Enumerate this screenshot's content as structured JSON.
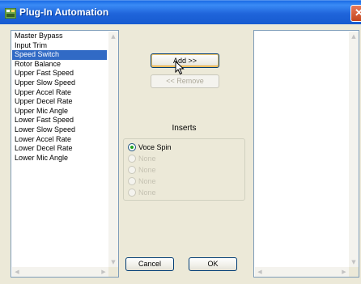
{
  "window": {
    "title": "Plug-In Automation",
    "close_glyph": "✕"
  },
  "available_list": {
    "items": [
      "Master Bypass",
      "Input Trim",
      "Speed Switch",
      "Rotor Balance",
      "Upper Fast Speed",
      "Upper Slow Speed",
      "Upper Accel Rate",
      "Upper Decel Rate",
      "Upper Mic Angle",
      "Lower Fast Speed",
      "Lower Slow Speed",
      "Lower Accel Rate",
      "Lower Decel Rate",
      "Lower Mic Angle"
    ],
    "selected": "Speed Switch"
  },
  "automated_list": {
    "items": []
  },
  "buttons": {
    "add_label": "Add >>",
    "remove_label": "<< Remove",
    "cancel_label": "Cancel",
    "ok_label": "OK"
  },
  "inserts": {
    "label": "Inserts",
    "options": [
      {
        "label": "Voce Spin",
        "selected": true,
        "enabled": true
      },
      {
        "label": "None",
        "selected": false,
        "enabled": false
      },
      {
        "label": "None",
        "selected": false,
        "enabled": false
      },
      {
        "label": "None",
        "selected": false,
        "enabled": false
      },
      {
        "label": "None",
        "selected": false,
        "enabled": false
      }
    ]
  },
  "icons": {
    "title_icon": "plugin-app-icon",
    "cursor": "mouse-pointer-icon"
  },
  "colors": {
    "titlebar": "#1f64da",
    "selection": "#316ac5",
    "dialog_bg": "#ece9d8",
    "radio_selected": "#21a121"
  }
}
